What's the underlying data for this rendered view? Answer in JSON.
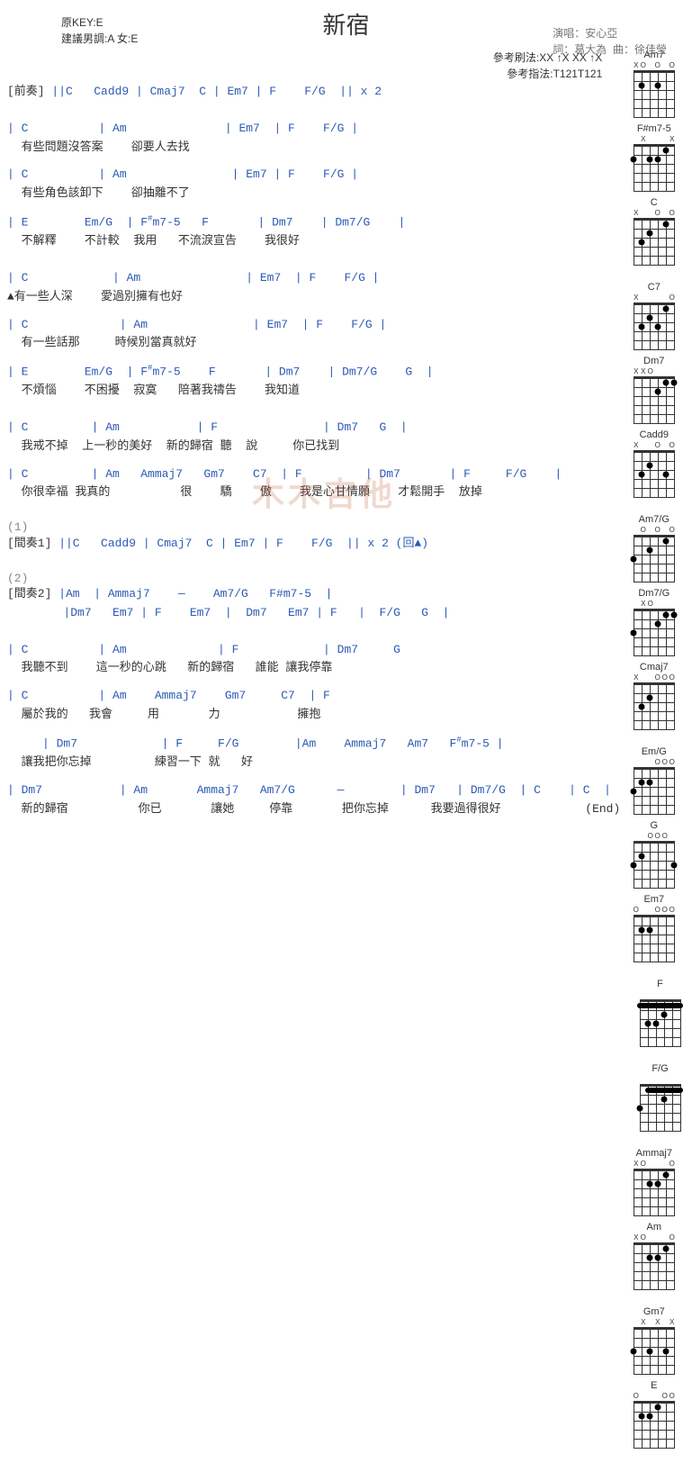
{
  "header": {
    "title": "新宿",
    "key": "原KEY:E",
    "suggest": "建議男調:A 女:E",
    "singer_label": "演唱：",
    "singer": "安心亞",
    "lyricist_label": "詞：",
    "lyricist": "葛大為",
    "composer_label": "曲：",
    "composer": "徐佳瑩",
    "strum_label": "參考刷法:",
    "strum": "XX ↑X XX ↑X",
    "finger_label": "參考指法:",
    "finger": "T121T121"
  },
  "intro": {
    "label": "[前奏]",
    "chords": " ||C   Cadd9 | Cmaj7  C | Em7 | F    F/G  || x 2"
  },
  "verse1": [
    {
      "c": "| C          | Am              | Em7  | F    F/G |",
      "l": "  有些問題沒答案    卻要人去找"
    },
    {
      "c": "| C          | Am               | Em7 | F    F/G |",
      "l": "  有些角色該卸下    卻抽離不了"
    },
    {
      "c": "| E        Em/G  | F#m7-5   F       | Dm7    | Dm7/G    |",
      "l": "  不解釋    不計較  我用   不流淚宣告    我很好"
    }
  ],
  "verse2": [
    {
      "c": "| C            | Am               | Em7  | F    F/G |",
      "l": "▲有一些人深    愛過別擁有也好"
    },
    {
      "c": "| C             | Am               | Em7  | F    F/G |",
      "l": "  有一些話那     時候別當真就好"
    },
    {
      "c": "| E        Em/G  | F#m7-5    F       | Dm7    | Dm7/G    G  |",
      "l": "  不煩惱    不困擾  寂寞   陪著我禱告    我知道"
    }
  ],
  "chorus1": [
    {
      "c": "| C         | Am           | F               | Dm7   G  |",
      "l": "  我戒不掉  上一秒的美好  新的歸宿 聽  說     你已找到"
    },
    {
      "c": "| C         | Am   Ammaj7   Gm7    C7  | F         | Dm7       | F     F/G    |",
      "l": "  你很幸福 我真的          很    驕    傲    我是心甘情願    才鬆開手  放掉"
    }
  ],
  "marker1": "(1)",
  "interlude1": {
    "label": "[間奏1]",
    "chords": " ||C   Cadd9 | Cmaj7  C | Em7 | F    F/G  || x 2 (回▲)"
  },
  "marker2": "(2)",
  "interlude2": {
    "label": "[間奏2]",
    "line1": " |Am  | Ammaj7    —    Am7/G   F#m7-5  |",
    "line2": "        |Dm7   Em7 | F    Em7  |  Dm7   Em7 | F   |  F/G   G  |"
  },
  "verse3": [
    {
      "c": "| C          | Am             | F            | Dm7     G",
      "l": "  我聽不到    這一秒的心跳   新的歸宿   誰能 讓我停靠"
    },
    {
      "c": "| C          | Am    Ammaj7    Gm7     C7  | F",
      "l": "  屬於我的   我會     用       力           擁抱"
    },
    {
      "c": "     | Dm7            | F     F/G        |Am    Ammaj7   Am7   F#m7-5 |",
      "l": "  讓我把你忘掉         練習一下 就   好"
    },
    {
      "c": "| Dm7           | Am       Ammaj7   Am7/G      —        | Dm7   | Dm7/G  | C    | C  |",
      "l": "  新的歸宿          你已       讓她     停靠       把你忘掉      我要過得很好            (End)"
    }
  ],
  "diagrams": {
    "row1": [
      "Am7",
      "F#m7-5",
      "C"
    ],
    "row2": [
      "C7",
      "Dm7",
      "Cadd9"
    ],
    "row3": [
      "Am7/G",
      "Dm7/G",
      "Cmaj7"
    ],
    "row4": [
      "Em/G",
      "G",
      "Em7"
    ],
    "row5": [
      "F"
    ],
    "row6": [
      "F/G"
    ],
    "row7": [
      "Ammaj7",
      "Am"
    ],
    "row8": [
      "Gm7",
      "E"
    ]
  },
  "chord_shapes": {
    "Am7": {
      "nut": [
        "X",
        "O",
        " ",
        "O",
        " ",
        "O"
      ],
      "dots": [
        [
          2,
          2
        ],
        [
          4,
          2
        ]
      ]
    },
    "F#m7-5": {
      "nut": [
        " ",
        "X",
        " ",
        " ",
        " ",
        "X"
      ],
      "dots": [
        [
          1,
          2
        ],
        [
          3,
          2
        ],
        [
          4,
          2
        ],
        [
          5,
          1
        ]
      ]
    },
    "C": {
      "nut": [
        "X",
        " ",
        " ",
        "O",
        " ",
        "O"
      ],
      "dots": [
        [
          2,
          3
        ],
        [
          3,
          2
        ],
        [
          5,
          1
        ]
      ]
    },
    "C7": {
      "nut": [
        "X",
        " ",
        " ",
        " ",
        " ",
        "O"
      ],
      "dots": [
        [
          2,
          3
        ],
        [
          3,
          2
        ],
        [
          4,
          3
        ],
        [
          5,
          1
        ]
      ]
    },
    "Dm7": {
      "nut": [
        "X",
        "X",
        "O",
        " ",
        " ",
        " "
      ],
      "dots": [
        [
          4,
          2
        ],
        [
          5,
          1
        ],
        [
          6,
          1
        ]
      ]
    },
    "Cadd9": {
      "nut": [
        "X",
        " ",
        " ",
        "O",
        " ",
        "O"
      ],
      "dots": [
        [
          2,
          3
        ],
        [
          3,
          2
        ],
        [
          5,
          3
        ]
      ]
    },
    "Am7/G": {
      "nut": [
        " ",
        "O",
        " ",
        "O",
        " ",
        "O"
      ],
      "dots": [
        [
          1,
          3
        ],
        [
          3,
          2
        ],
        [
          5,
          1
        ]
      ]
    },
    "Dm7/G": {
      "nut": [
        " ",
        "X",
        "O",
        " ",
        " ",
        " "
      ],
      "dots": [
        [
          1,
          3
        ],
        [
          4,
          2
        ],
        [
          5,
          1
        ],
        [
          6,
          1
        ]
      ]
    },
    "Cmaj7": {
      "nut": [
        "X",
        " ",
        " ",
        "O",
        "O",
        "O"
      ],
      "dots": [
        [
          2,
          3
        ],
        [
          3,
          2
        ]
      ]
    },
    "Em/G": {
      "nut": [
        " ",
        " ",
        " ",
        "O",
        "O",
        "O"
      ],
      "dots": [
        [
          1,
          3
        ],
        [
          2,
          2
        ],
        [
          3,
          2
        ]
      ]
    },
    "G": {
      "nut": [
        " ",
        " ",
        "O",
        "O",
        "O",
        " "
      ],
      "dots": [
        [
          1,
          3
        ],
        [
          2,
          2
        ],
        [
          6,
          3
        ]
      ]
    },
    "Em7": {
      "nut": [
        "O",
        " ",
        " ",
        "O",
        "O",
        "O"
      ],
      "dots": [
        [
          2,
          2
        ],
        [
          3,
          2
        ]
      ]
    },
    "F": {
      "nut": [
        " ",
        " ",
        " ",
        " ",
        " ",
        " "
      ],
      "dots": [
        [
          2,
          3
        ],
        [
          3,
          3
        ],
        [
          4,
          2
        ]
      ],
      "barre": {
        "fret": 1,
        "from": 1,
        "to": 6
      }
    },
    "F/G": {
      "nut": [
        " ",
        " ",
        " ",
        " ",
        " ",
        " "
      ],
      "dots": [
        [
          1,
          3
        ],
        [
          4,
          2
        ]
      ],
      "barre": {
        "fret": 1,
        "from": 2,
        "to": 6
      }
    },
    "Ammaj7": {
      "nut": [
        "X",
        "O",
        " ",
        " ",
        " ",
        "O"
      ],
      "dots": [
        [
          3,
          2
        ],
        [
          4,
          2
        ],
        [
          5,
          1
        ]
      ]
    },
    "Am": {
      "nut": [
        "X",
        "O",
        " ",
        " ",
        " ",
        "O"
      ],
      "dots": [
        [
          3,
          2
        ],
        [
          4,
          2
        ],
        [
          5,
          1
        ]
      ]
    },
    "Gm7": {
      "nut": [
        " ",
        "X",
        " ",
        "X",
        " ",
        "X"
      ],
      "dots": [
        [
          1,
          3
        ],
        [
          3,
          3
        ],
        [
          5,
          3
        ]
      ]
    },
    "E": {
      "nut": [
        "O",
        " ",
        " ",
        " ",
        "O",
        "O"
      ],
      "dots": [
        [
          2,
          2
        ],
        [
          3,
          2
        ],
        [
          4,
          1
        ]
      ]
    }
  }
}
